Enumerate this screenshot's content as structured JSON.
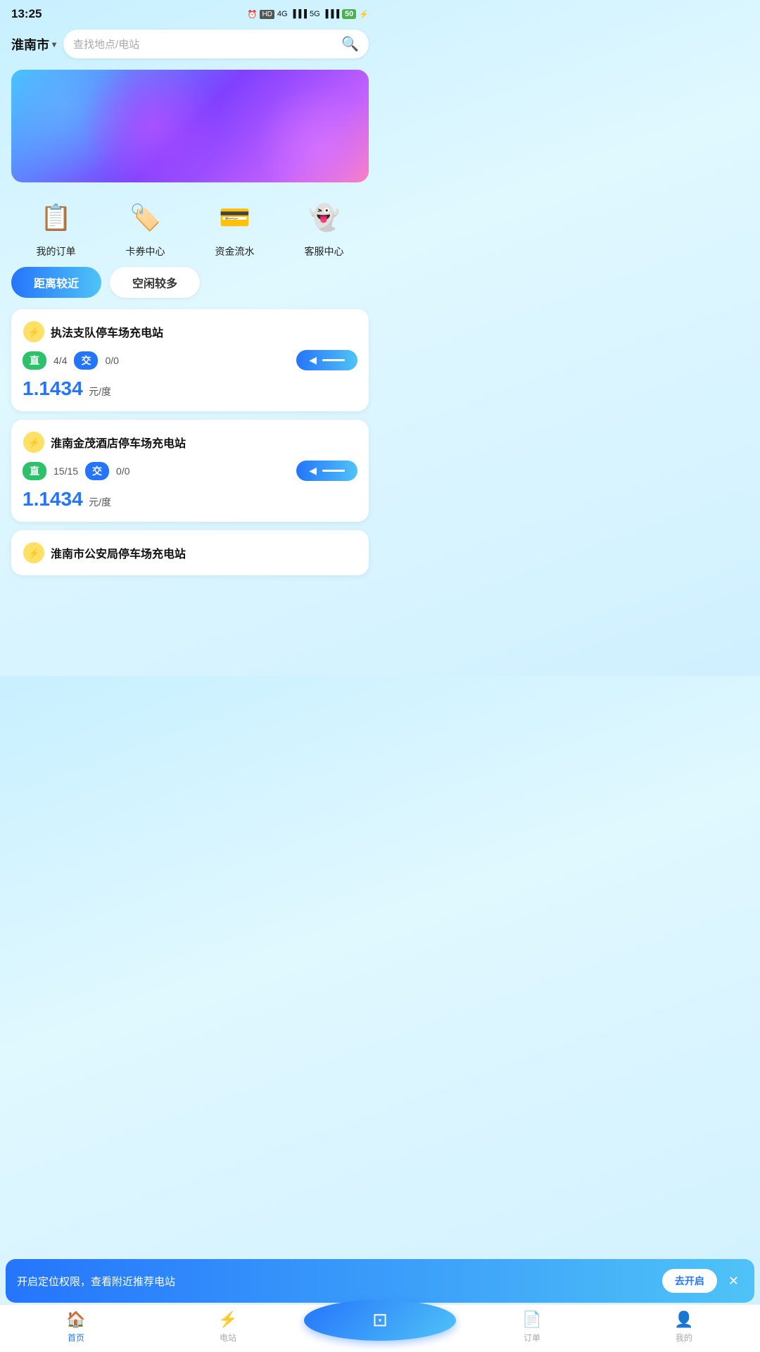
{
  "statusBar": {
    "time": "13:25",
    "battery": "50",
    "signal4g": "4G",
    "signal5g": "5G"
  },
  "header": {
    "city": "淮南市",
    "chevron": "▾",
    "searchPlaceholder": "查找地点/电站"
  },
  "quickActions": [
    {
      "id": "my-orders",
      "label": "我的订单",
      "icon": "📋"
    },
    {
      "id": "coupon-center",
      "label": "卡券中心",
      "icon": "🏷️"
    },
    {
      "id": "funds-flow",
      "label": "资金流水",
      "icon": "💳"
    },
    {
      "id": "customer-service",
      "label": "客服中心",
      "icon": "👻"
    }
  ],
  "filterTabs": [
    {
      "id": "nearby",
      "label": "距离较近",
      "active": true
    },
    {
      "id": "available",
      "label": "空闲较多",
      "active": false
    }
  ],
  "stations": [
    {
      "id": "station-1",
      "name": "执法支队停车场充电站",
      "directCount": "4",
      "directTotal": "4",
      "acCount": "0",
      "acTotal": "0",
      "price": "1.1434",
      "priceUnit": "元/度"
    },
    {
      "id": "station-2",
      "name": "淮南金茂酒店停车场充电站",
      "directCount": "15",
      "directTotal": "15",
      "acCount": "0",
      "acTotal": "0",
      "price": "1.1434",
      "priceUnit": "元/度"
    },
    {
      "id": "station-3",
      "name": "淮南市公安局停车场充电站",
      "partial": true
    }
  ],
  "locationBanner": {
    "text": "开启定位权限，查看附近推荐电站",
    "enableLabel": "去开启"
  },
  "bottomNav": [
    {
      "id": "home",
      "label": "首页",
      "active": true,
      "icon": "🏠"
    },
    {
      "id": "station",
      "label": "电站",
      "active": false,
      "icon": "⚡"
    },
    {
      "id": "scan",
      "label": "",
      "active": false,
      "icon": "⊡",
      "isScan": true
    },
    {
      "id": "orders",
      "label": "订单",
      "active": false,
      "icon": "📄"
    },
    {
      "id": "mine",
      "label": "我的",
      "active": false,
      "icon": "👤"
    }
  ],
  "labels": {
    "direct": "直",
    "ac": "交",
    "navigate": "—"
  }
}
